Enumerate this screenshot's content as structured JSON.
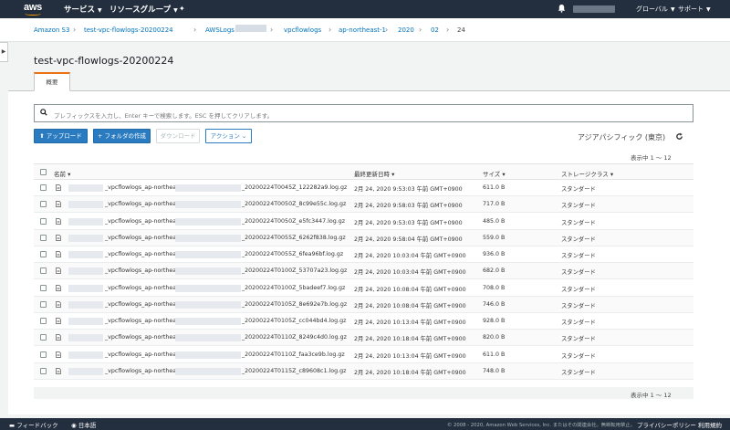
{
  "topnav": {
    "logo_text": "aws",
    "services": "サービス",
    "resource_groups": "リソースグループ",
    "region": "グローバル",
    "support": "サポート"
  },
  "breadcrumb": {
    "items": [
      "Amazon S3",
      "test-vpc-flowlogs-20200224",
      "AWSLogs",
      "vpcflowlogs",
      "ap-northeast-1",
      "2020",
      "02"
    ],
    "current": "24"
  },
  "page": {
    "title": "test-vpc-flowlogs-20200224",
    "tab_overview": "概要"
  },
  "search": {
    "placeholder": "プレフィックスを入力し、Enter キーで検索します。ESC を押してクリアします。"
  },
  "toolbar": {
    "upload": "アップロード",
    "create_folder": "フォルダの作成",
    "download": "ダウンロード",
    "actions": "アクション",
    "region_label": "アジアパシフィック (東京)"
  },
  "pagination": {
    "top": "表示中 1 ～ 12",
    "bottom": "表示中 1 ～ 12"
  },
  "table": {
    "headers": {
      "name": "名前",
      "modified": "最終更新日時",
      "size": "サイズ",
      "storage_class": "ストレージクラス"
    },
    "rows": [
      {
        "name_mid": "_vpcflowlogs_ap-northeast-",
        "name_end": "_20200224T0045Z_122282a9.log.gz",
        "modified": "2月 24, 2020 9:53:03 午前 GMT+0900",
        "size": "611.0 B",
        "storage": "スタンダード"
      },
      {
        "name_mid": "_vpcflowlogs_ap-northeast-",
        "name_end": "_20200224T0050Z_8c99e55c.log.gz",
        "modified": "2月 24, 2020 9:58:03 午前 GMT+0900",
        "size": "717.0 B",
        "storage": "スタンダード"
      },
      {
        "name_mid": "_vpcflowlogs_ap-northeast-",
        "name_end": "_20200224T0050Z_e5fc3447.log.gz",
        "modified": "2月 24, 2020 9:53:03 午前 GMT+0900",
        "size": "485.0 B",
        "storage": "スタンダード"
      },
      {
        "name_mid": "_vpcflowlogs_ap-northeast-",
        "name_end": "_20200224T0055Z_6262f838.log.gz",
        "modified": "2月 24, 2020 9:58:04 午前 GMT+0900",
        "size": "559.0 B",
        "storage": "スタンダード"
      },
      {
        "name_mid": "_vpcflowlogs_ap-northeast-",
        "name_end": "_20200224T0055Z_6fea96bf.log.gz",
        "modified": "2月 24, 2020 10:03:04 午前 GMT+0900",
        "size": "936.0 B",
        "storage": "スタンダード"
      },
      {
        "name_mid": "_vpcflowlogs_ap-northeast-",
        "name_end": "_20200224T0100Z_53707a23.log.gz",
        "modified": "2月 24, 2020 10:03:04 午前 GMT+0900",
        "size": "682.0 B",
        "storage": "スタンダード"
      },
      {
        "name_mid": "_vpcflowlogs_ap-northeast-",
        "name_end": "_20200224T0100Z_5badeef7.log.gz",
        "modified": "2月 24, 2020 10:08:04 午前 GMT+0900",
        "size": "708.0 B",
        "storage": "スタンダード"
      },
      {
        "name_mid": "_vpcflowlogs_ap-northeast-",
        "name_end": "_20200224T0105Z_8e692e7b.log.gz",
        "modified": "2月 24, 2020 10:08:04 午前 GMT+0900",
        "size": "746.0 B",
        "storage": "スタンダード"
      },
      {
        "name_mid": "_vpcflowlogs_ap-northeast-",
        "name_end": "_20200224T0105Z_cc044bd4.log.gz",
        "modified": "2月 24, 2020 10:13:04 午前 GMT+0900",
        "size": "928.0 B",
        "storage": "スタンダード"
      },
      {
        "name_mid": "_vpcflowlogs_ap-northeast-",
        "name_end": "_20200224T0110Z_8249c4d0.log.gz",
        "modified": "2月 24, 2020 10:18:04 午前 GMT+0900",
        "size": "820.0 B",
        "storage": "スタンダード"
      },
      {
        "name_mid": "_vpcflowlogs_ap-northeast-",
        "name_end": "_20200224T0110Z_faa3ce9b.log.gz",
        "modified": "2月 24, 2020 10:13:04 午前 GMT+0900",
        "size": "611.0 B",
        "storage": "スタンダード"
      },
      {
        "name_mid": "_vpcflowlogs_ap-northeast-",
        "name_end": "_20200224T0115Z_c89608c1.log.gz",
        "modified": "2月 24, 2020 10:18:04 午前 GMT+0900",
        "size": "748.0 B",
        "storage": "スタンダード"
      }
    ]
  },
  "footer": {
    "feedback": "フィードバック",
    "language": "日本語",
    "copyright": "© 2008 - 2020, Amazon Web Services, Inc. またはその関連会社。無断転用禁止。",
    "privacy": "プライバシーポリシー",
    "terms": "利用規約"
  },
  "colors": {
    "nav_bg": "#232f3e",
    "accent": "#ec7211",
    "link": "#0073bb",
    "primary_button": "#2b7bc0"
  },
  "icons": [
    "caret-down-icon",
    "pin-icon",
    "bell-icon",
    "chevron-right-icon",
    "search-icon",
    "upload-icon",
    "plus-icon",
    "refresh-icon",
    "file-icon",
    "feedback-icon",
    "globe-icon"
  ]
}
